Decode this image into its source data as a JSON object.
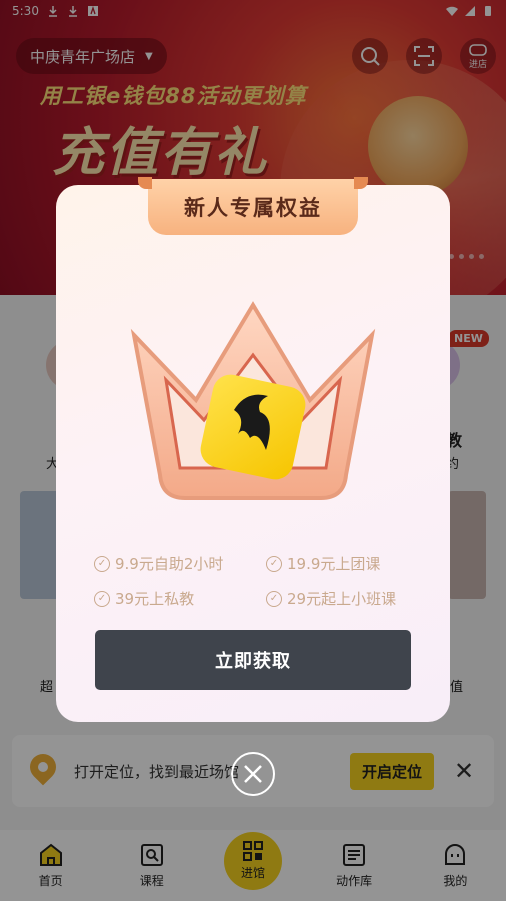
{
  "status_bar": {
    "time": "5:30"
  },
  "header": {
    "store_name": "中庚青年广场店",
    "enter_store_label": "进店"
  },
  "banner": {
    "line1": "用工银e钱包88活动更划算",
    "big_text": "充值有礼"
  },
  "background_hints": {
    "left_label_1": "大",
    "right_label_1": "教",
    "right_label_2": "约",
    "left_label_2": "超",
    "right_label_3": "值",
    "new_tag": "NEW"
  },
  "location_bar": {
    "text": "打开定位，找到最近场馆",
    "button": "开启定位"
  },
  "modal": {
    "title": "新人专属权益",
    "benefits": [
      "9.9元自助2小时",
      "19.9元上团课",
      "39元上私教",
      "29元起上小班课"
    ],
    "button": "立即获取"
  },
  "bottom_nav": [
    {
      "label": "首页",
      "icon": "home-icon"
    },
    {
      "label": "课程",
      "icon": "course-icon"
    },
    {
      "label": "进馆",
      "icon": "qr-icon"
    },
    {
      "label": "动作库",
      "icon": "library-icon"
    },
    {
      "label": "我的",
      "icon": "profile-icon"
    }
  ],
  "colors": {
    "accent_yellow": "#f7d21f",
    "dark_button": "#3f444c",
    "banner_red": "#c8202d"
  }
}
